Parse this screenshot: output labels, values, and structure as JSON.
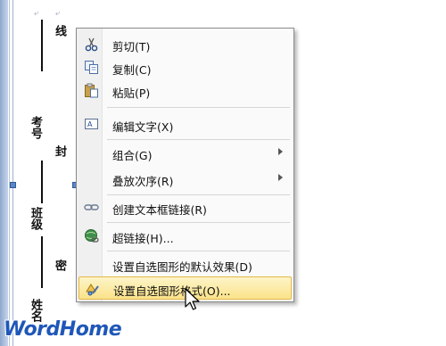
{
  "document": {
    "binding_labels": {
      "line": "线",
      "seal": "封",
      "close": "密",
      "exam_no": "考号",
      "class": "班级",
      "name": "姓名"
    }
  },
  "context_menu": {
    "items": [
      {
        "label": "剪切(T)",
        "icon": "scissors-icon"
      },
      {
        "label": "复制(C)",
        "icon": "copy-icon"
      },
      {
        "label": "粘贴(P)",
        "icon": "paste-icon"
      },
      {
        "label": "编辑文字(X)",
        "icon": "edit-text-icon"
      },
      {
        "label": "组合(G)",
        "submenu": true
      },
      {
        "label": "叠放次序(R)",
        "submenu": true
      },
      {
        "label": "创建文本框链接(R)",
        "icon": "chain-link-icon"
      },
      {
        "label": "超链接(H)...",
        "icon": "globe-link-icon"
      },
      {
        "label": "设置自选图形的默认效果(D)"
      },
      {
        "label": "设置自选图形格式(O)...",
        "icon": "format-shape-icon",
        "highlighted": true
      }
    ]
  },
  "watermark": {
    "text": "WordHome"
  },
  "colors": {
    "highlight": "#fbe38a",
    "watermark": "#1f57b8"
  }
}
